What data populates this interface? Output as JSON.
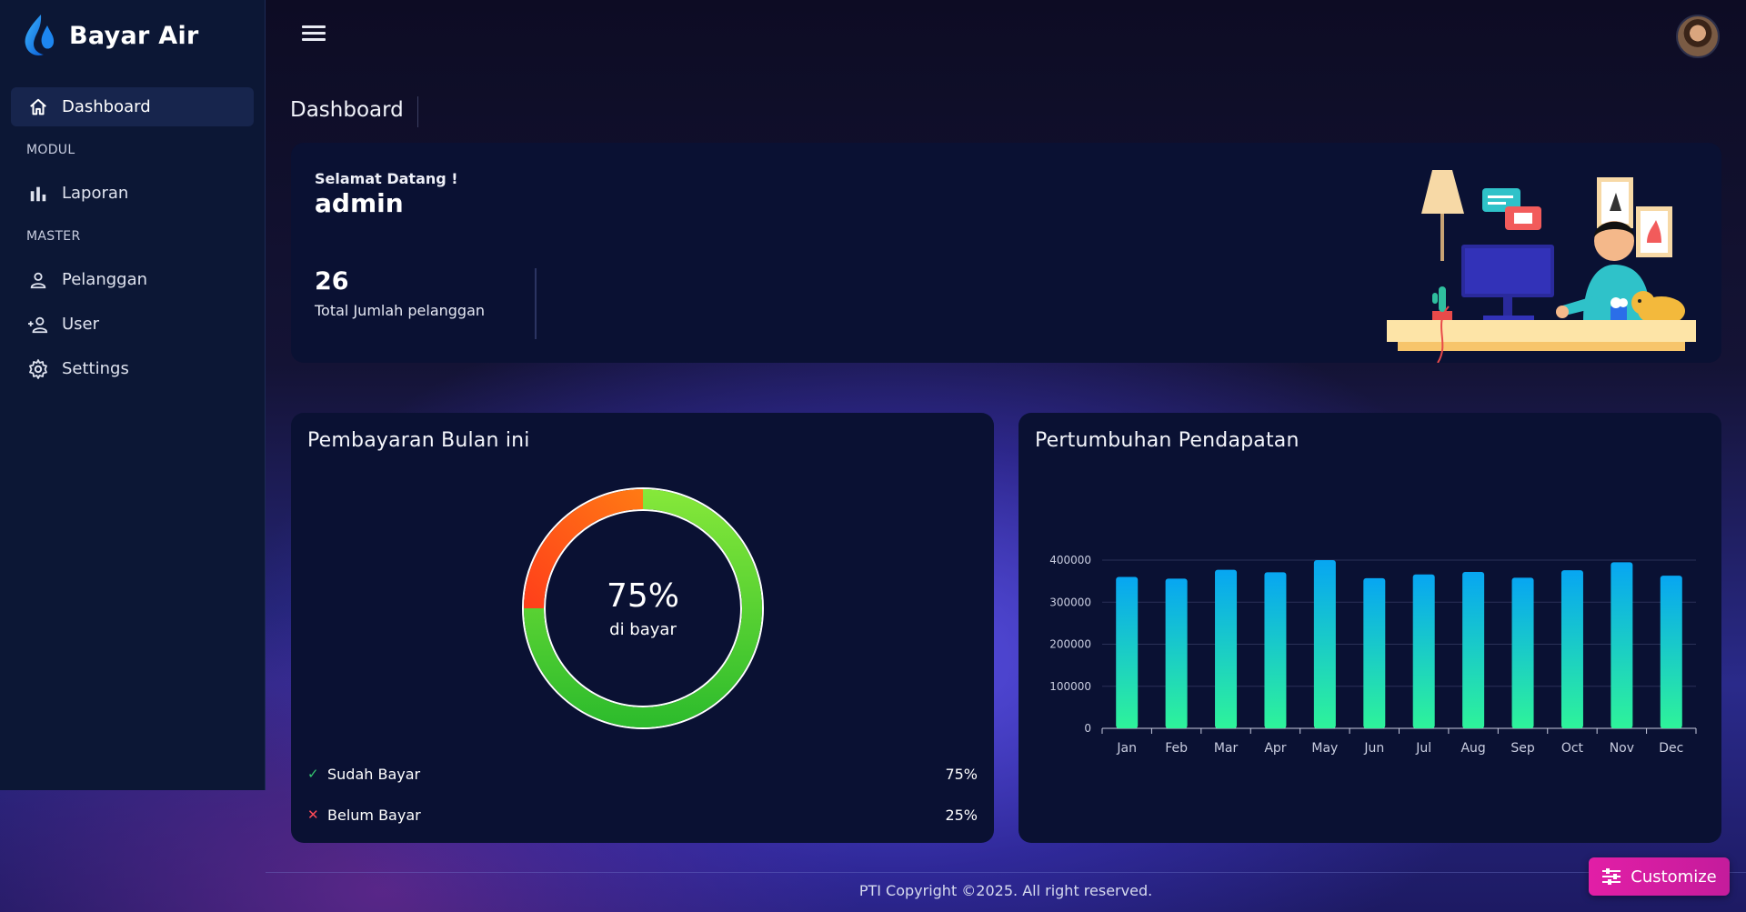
{
  "brand": {
    "name": "Bayar Air"
  },
  "sidebar": {
    "items": [
      {
        "label": "Dashboard",
        "icon": "home-icon"
      },
      {
        "section": "MODUL"
      },
      {
        "label": "Laporan",
        "icon": "bar-chart-icon"
      },
      {
        "section": "MASTER"
      },
      {
        "label": "Pelanggan",
        "icon": "person-icon"
      },
      {
        "label": "User",
        "icon": "person-add-icon"
      },
      {
        "label": "Settings",
        "icon": "gear-icon"
      }
    ]
  },
  "header": {
    "page_title": "Dashboard"
  },
  "welcome": {
    "greeting": "Selamat Datang !",
    "username": "admin",
    "stat_value": "26",
    "stat_label": "Total Jumlah pelanggan"
  },
  "payment": {
    "title": "Pembayaran Bulan ini",
    "center_value": "75%",
    "center_label": "di bayar",
    "legend": [
      {
        "label": "Sudah Bayar",
        "value": "75%"
      },
      {
        "label": "Belum Bayar",
        "value": "25%"
      }
    ]
  },
  "revenue": {
    "title": "Pertumbuhan Pendapatan"
  },
  "chart_data": [
    {
      "type": "pie",
      "categories": [
        "Sudah Bayar",
        "Belum Bayar"
      ],
      "values": [
        75,
        25
      ],
      "colors": [
        "#5fcf2f",
        "#ff5a1a"
      ]
    },
    {
      "type": "bar",
      "categories": [
        "Jan",
        "Feb",
        "Mar",
        "Apr",
        "May",
        "Jun",
        "Jul",
        "Aug",
        "Sep",
        "Oct",
        "Nov",
        "Dec"
      ],
      "values": [
        360000,
        356000,
        377000,
        371000,
        400000,
        357000,
        366000,
        372000,
        358000,
        376000,
        395000,
        363000
      ],
      "yticks": [
        "0",
        "100000",
        "200000",
        "300000",
        "400000"
      ],
      "ylim": [
        0,
        400000
      ],
      "grid": true,
      "colors": [
        "#07a6f2",
        "#2ef39a"
      ]
    }
  ],
  "footer": {
    "text": "PTI Copyright ©2025. All right reserved."
  },
  "customize": {
    "label": "Customize"
  }
}
